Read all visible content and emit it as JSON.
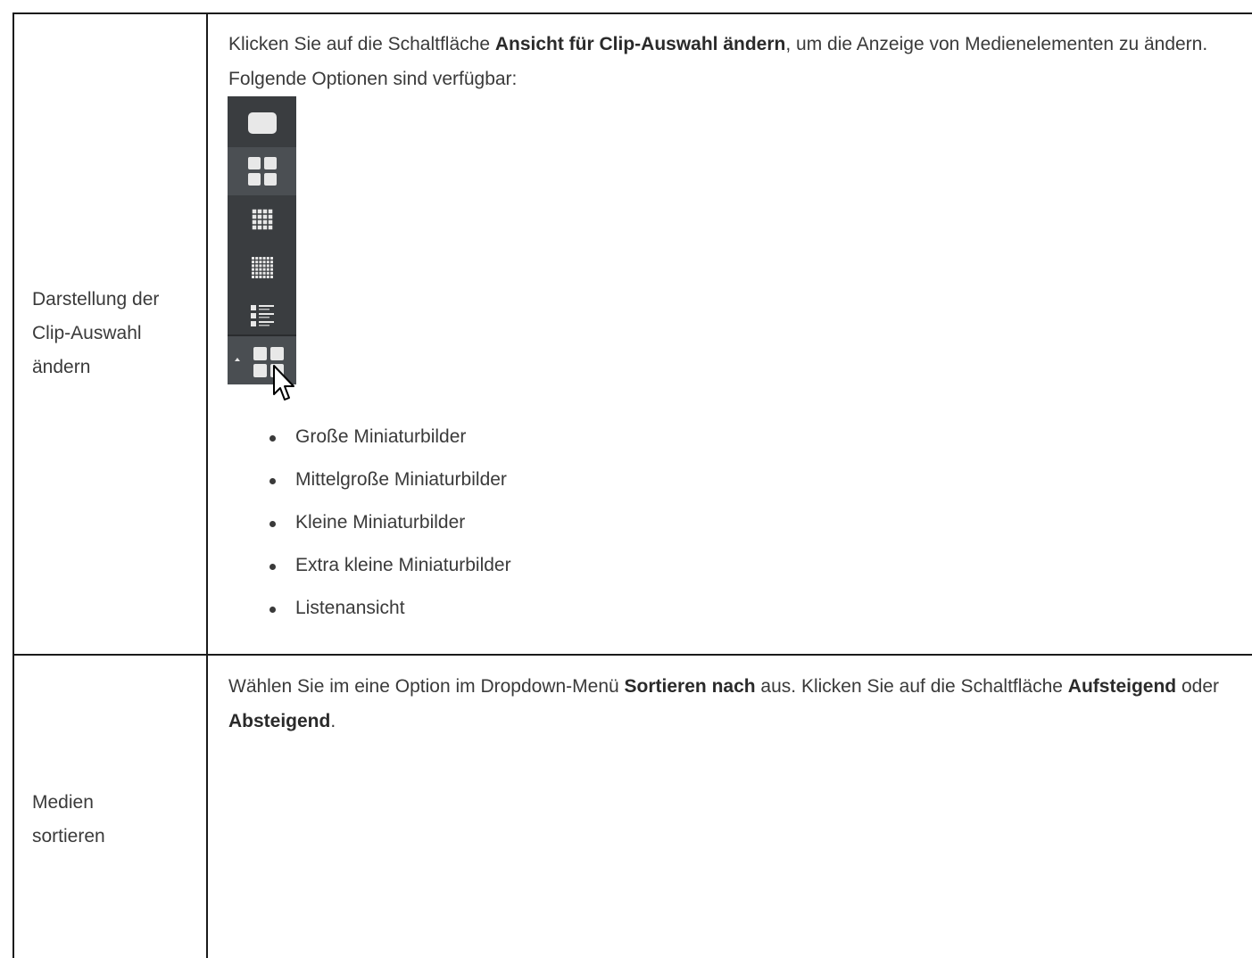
{
  "rows": [
    {
      "label_lines": [
        "Darstellung der",
        "Clip-Auswahl",
        "ändern"
      ],
      "desc": {
        "pre": "Klicken Sie auf die Schaltfläche ",
        "bold1": "Ansicht für Clip-Auswahl ändern",
        "post": ", um die Anzeige von Medienelementen zu ändern. Folgende Optionen sind verfügbar:"
      },
      "toolbar": {
        "items": [
          "large-thumbnails-icon",
          "medium-thumbnails-icon",
          "small-thumbnails-icon",
          "extra-small-thumbnails-icon",
          "list-view-icon"
        ],
        "selected_index": 1,
        "button_icon": "medium-thumbnails-icon"
      },
      "options": [
        "Große Miniaturbilder",
        "Mittelgroße Miniaturbilder",
        "Kleine Miniaturbilder",
        "Extra kleine Miniaturbilder",
        "Listenansicht"
      ]
    },
    {
      "label_lines": [
        "Medien",
        "sortieren"
      ],
      "desc": {
        "pre": "Wählen Sie im eine Option im Dropdown-Menü ",
        "bold1": "Sortieren nach",
        "mid": " aus. Klicken Sie auf die Schaltfläche ",
        "bold2": "Aufsteigend",
        "mid2": " oder ",
        "bold3": "Absteigend",
        "post": "."
      }
    }
  ],
  "colors": {
    "text": "#3a3a3a",
    "border": "#1a1a1a",
    "toolbar_bg": "#3a3d40",
    "toolbar_selected": "#4b4f53",
    "icon": "#e8e8e8"
  }
}
